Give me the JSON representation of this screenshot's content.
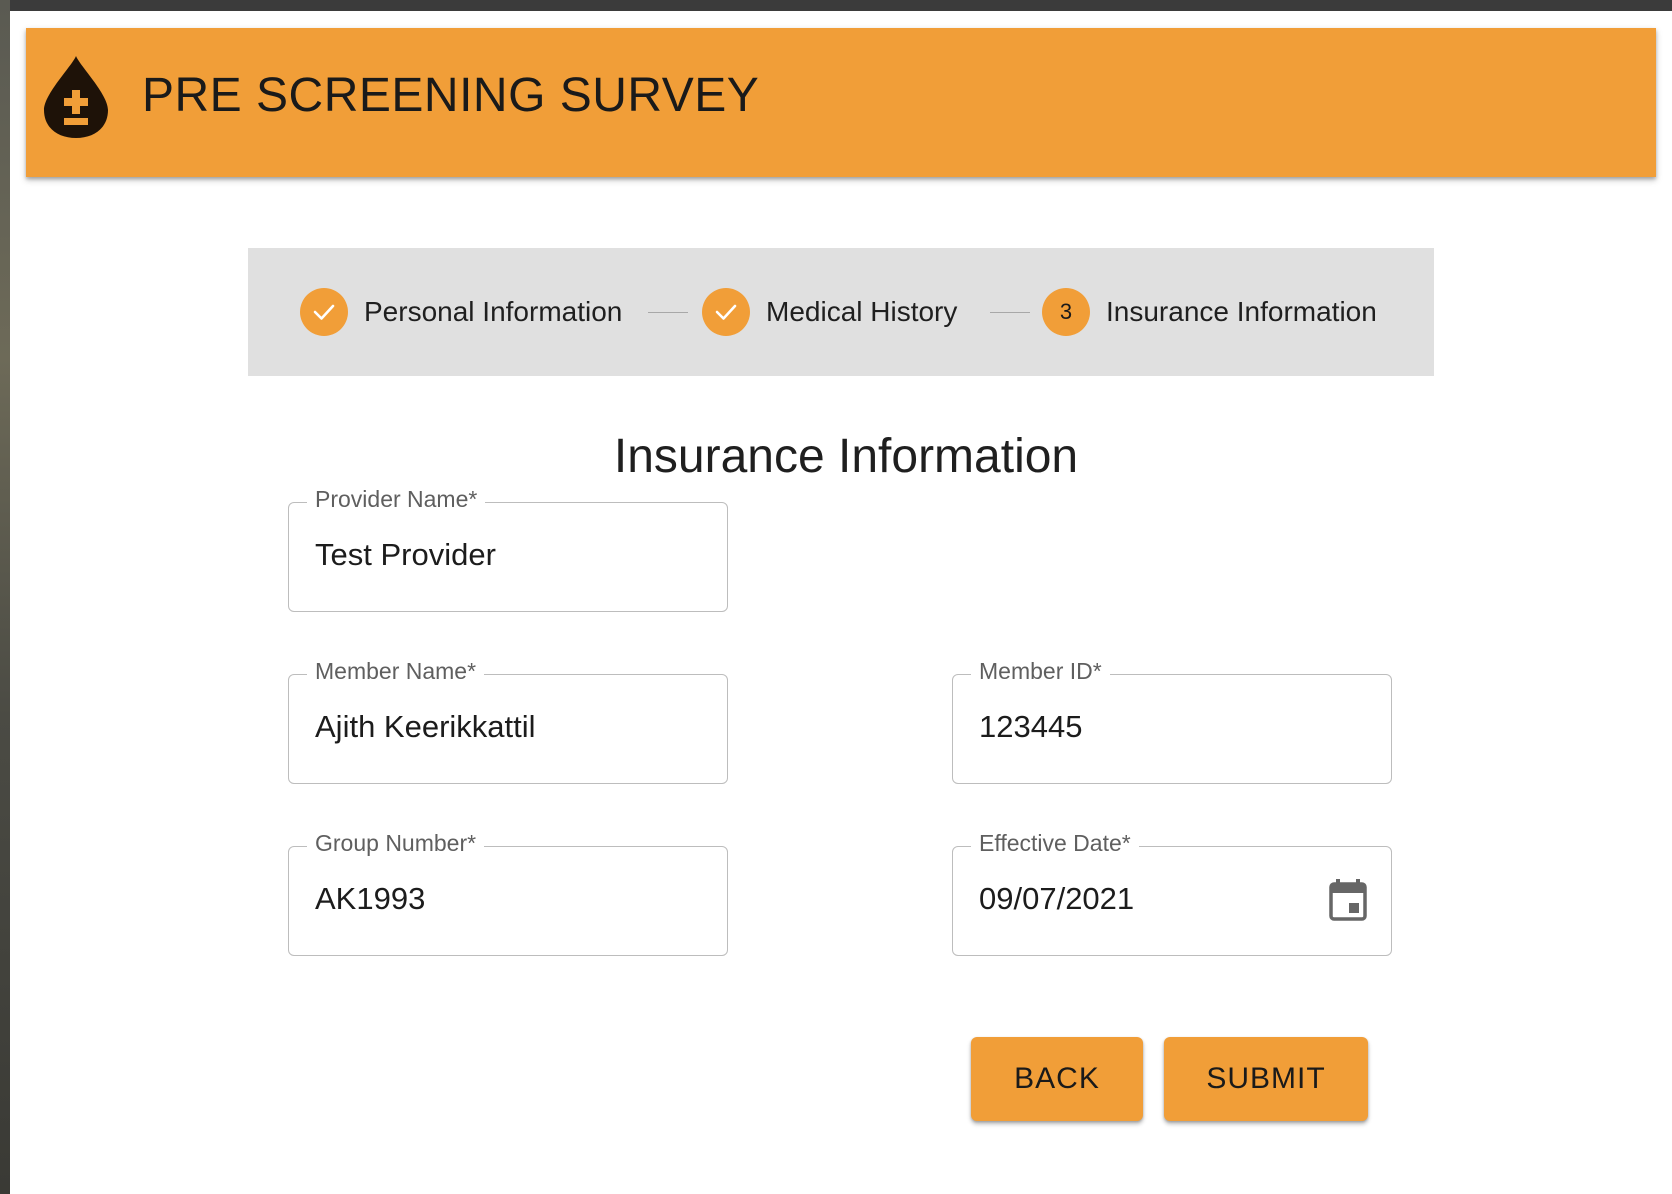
{
  "app": {
    "title": "PRE SCREENING SURVEY",
    "logo_icon": "blood-drop-plus-minus-icon",
    "accent_color": "#f19e38"
  },
  "stepper": {
    "steps": [
      {
        "label": "Personal Information",
        "status": "completed",
        "icon": "check-icon"
      },
      {
        "label": "Medical History",
        "status": "completed",
        "icon": "check-icon"
      },
      {
        "label": "Insurance Information",
        "status": "active",
        "number": "3"
      }
    ]
  },
  "form": {
    "title": "Insurance Information",
    "fields": {
      "provider_name": {
        "label": "Provider Name",
        "required": "*",
        "value": "Test Provider"
      },
      "member_name": {
        "label": "Member Name",
        "required": "*",
        "value": "Ajith Keerikkattil"
      },
      "member_id": {
        "label": "Member ID",
        "required": "*",
        "value": "123445"
      },
      "group_number": {
        "label": "Group Number",
        "required": "*",
        "value": "AK1993"
      },
      "effective_date": {
        "label": "Effective Date",
        "required": "*",
        "value": "09/07/2021",
        "icon": "calendar-icon"
      }
    }
  },
  "actions": {
    "back_label": "BACK",
    "submit_label": "SUBMIT"
  }
}
